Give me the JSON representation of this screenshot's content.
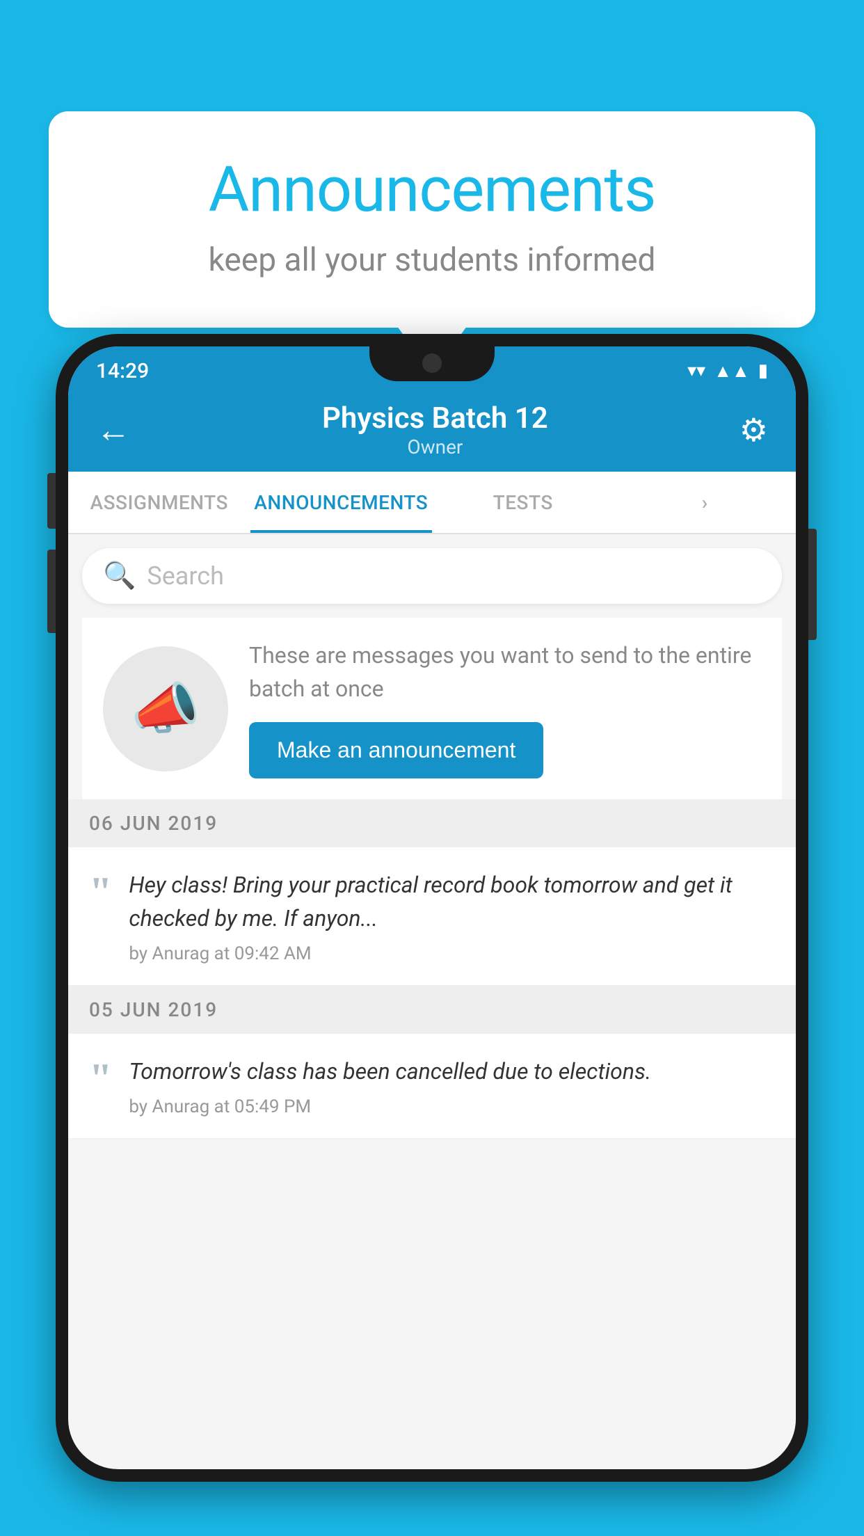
{
  "background_color": "#1ab8e8",
  "speech_bubble": {
    "title": "Announcements",
    "subtitle": "keep all your students informed"
  },
  "phone": {
    "status_bar": {
      "time": "14:29",
      "icons": [
        "wifi",
        "signal",
        "battery"
      ]
    },
    "header": {
      "back_label": "←",
      "title": "Physics Batch 12",
      "subtitle": "Owner",
      "settings_label": "⚙"
    },
    "tabs": [
      {
        "label": "ASSIGNMENTS",
        "active": false
      },
      {
        "label": "ANNOUNCEMENTS",
        "active": true
      },
      {
        "label": "TESTS",
        "active": false
      },
      {
        "label": "",
        "active": false
      }
    ],
    "search": {
      "placeholder": "Search"
    },
    "announce_intro": {
      "description": "These are messages you want to send to the entire batch at once",
      "button_label": "Make an announcement"
    },
    "announcements": [
      {
        "date": "06  JUN  2019",
        "message": "Hey class! Bring your practical record book tomorrow and get it checked by me. If anyon...",
        "author": "by Anurag at 09:42 AM"
      },
      {
        "date": "05  JUN  2019",
        "message": "Tomorrow's class has been cancelled due to elections.",
        "author": "by Anurag at 05:49 PM"
      }
    ]
  }
}
